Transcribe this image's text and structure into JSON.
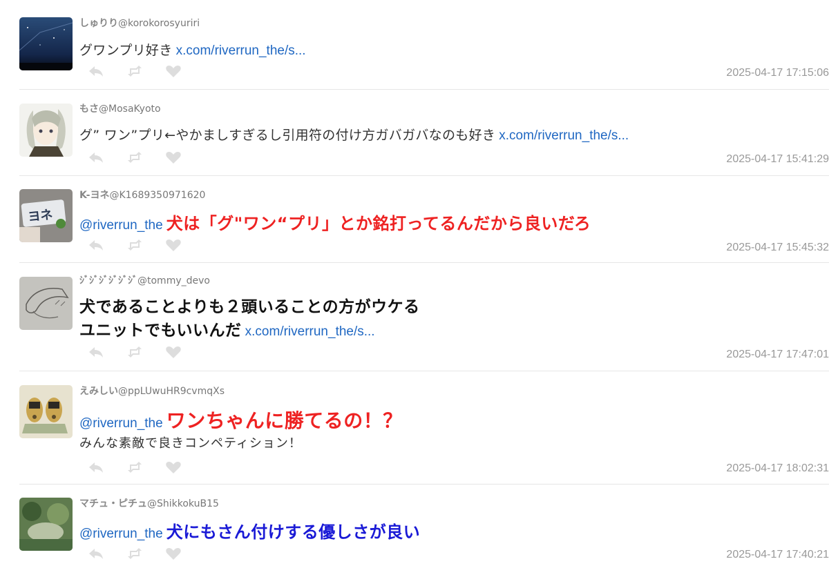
{
  "tweets": [
    {
      "display_name": "しゅりり",
      "handle": "@korokorosyuriri",
      "text": "グワンプリ好き",
      "link": "x.com/riverrun_the/s...",
      "timestamp": "2025-04-17 17:15:06"
    },
    {
      "display_name": "もさ",
      "handle": "@MosaKyoto",
      "text": "グ” ワン”プリ←やかましすぎるし引用符の付け方ガバガバなのも好き",
      "link": "x.com/riverrun_the/s...",
      "timestamp": "2025-04-17 15:41:29"
    },
    {
      "display_name": "K-ヨネ",
      "handle": "@K1689350971620",
      "mention": "@riverrun_the",
      "text": "犬は「グ\"ワン“プリ」とか銘打ってるんだから良いだろ",
      "timestamp": "2025-04-17 15:45:32"
    },
    {
      "display_name": "ｼﾞｼﾞｼﾞｼﾞｼﾞｼﾞ",
      "handle": "@tommy_devo",
      "text_line1": "犬であることよりも２頭いることの方がウケる",
      "text_line2": "ユニットでもいいんだ",
      "link": "x.com/riverrun_the/s...",
      "timestamp": "2025-04-17 17:47:01"
    },
    {
      "display_name": "えみしい",
      "handle": "@ppLUwuHR9cvmqXs",
      "mention": "@riverrun_the",
      "text": "ワンちゃんに勝てるの！？",
      "text_line2": "みんな素敵で良きコンペティション！",
      "timestamp": "2025-04-17 18:02:31"
    },
    {
      "display_name": "マチュ・ピチュ",
      "handle": "@ShikkokuB15",
      "mention": "@riverrun_the",
      "text": "犬にもさん付けする優しさが良い",
      "timestamp": "2025-04-17 17:40:21"
    }
  ],
  "colors": {
    "link": "#1f67c2",
    "emphasis_red": "#ee2222",
    "emphasis_blue": "#1a1ad6",
    "icon": "#dddddd",
    "timestamp": "#999999"
  },
  "icons": [
    "reply-icon",
    "retweet-icon",
    "like-icon"
  ]
}
